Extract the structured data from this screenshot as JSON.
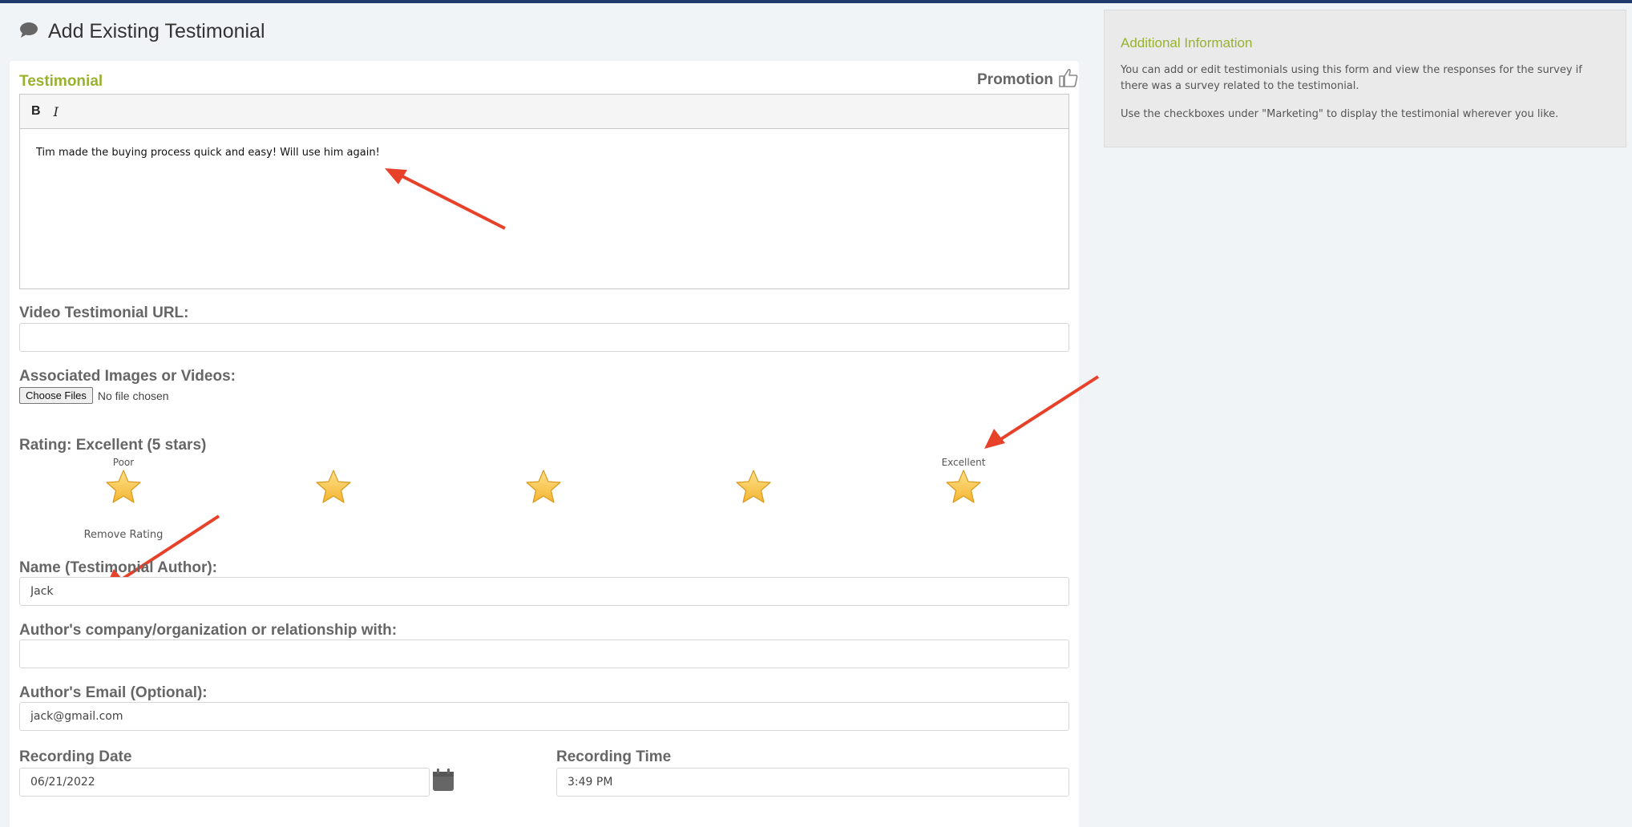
{
  "colors": {
    "accent_green": "#98b22e",
    "topbar": "#1f3a6b",
    "star": "#f5b532",
    "annotation_arrow": "#e8412a"
  },
  "header": {
    "title": "Add Existing Testimonial",
    "icon": "speech-bubble-icon"
  },
  "testimonial": {
    "section_label": "Testimonial",
    "promotion_label": "Promotion",
    "promotion_icon": "thumbs-up-icon",
    "toolbar": {
      "bold": "B",
      "italic": "I"
    },
    "body": "Tim made the buying process quick and easy! Will use him again!"
  },
  "video_url": {
    "label": "Video Testimonial URL:",
    "value": ""
  },
  "attachments": {
    "label": "Associated Images or Videos:",
    "button": "Choose Files",
    "status": "No file chosen"
  },
  "rating": {
    "label": "Rating: Excellent (5 stars)",
    "value": 5,
    "max": 5,
    "low_label": "Poor",
    "high_label": "Excellent",
    "remove_label": "Remove Rating"
  },
  "author_name": {
    "label": "Name (Testimonial Author):",
    "value": "Jack"
  },
  "author_company": {
    "label": "Author's company/organization or relationship with:",
    "value": ""
  },
  "author_email": {
    "label": "Author's Email (Optional):",
    "value": "jack@gmail.com"
  },
  "recording_date": {
    "label": "Recording Date",
    "value": "06/21/2022",
    "icon": "calendar-icon"
  },
  "recording_time": {
    "label": "Recording Time",
    "value": "3:49 PM"
  },
  "side_panel": {
    "title": "Additional Information",
    "paragraph1": "You can add or edit testimonials using this form and view the responses for the survey if there was a survey related to the testimonial.",
    "paragraph2": "Use the checkboxes under \"Marketing\" to display the testimonial wherever you like."
  }
}
